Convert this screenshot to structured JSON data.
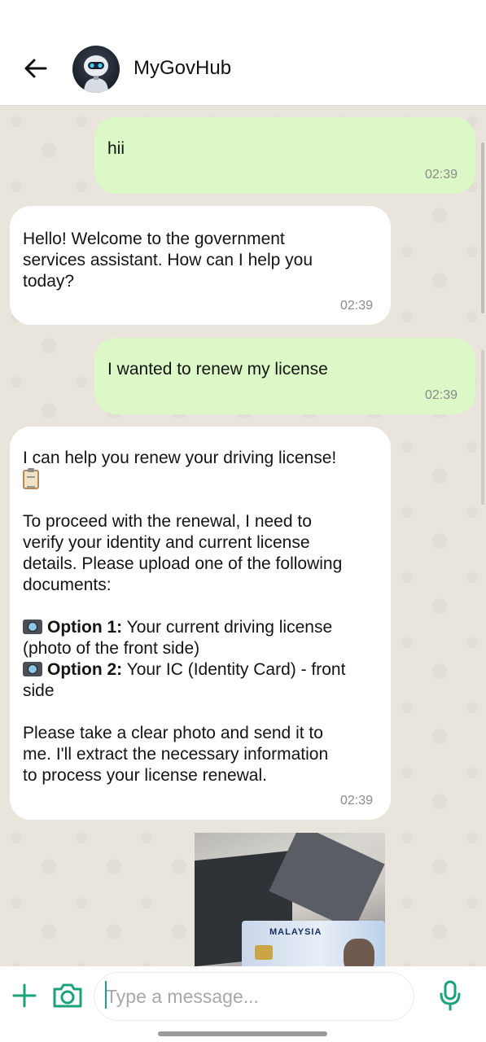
{
  "header": {
    "contact_name": "MyGovHub"
  },
  "messages": [
    {
      "direction": "outgoing",
      "lines": [
        "hii"
      ],
      "time": "02:39"
    },
    {
      "direction": "incoming",
      "lines": [
        "Hello! Welcome to the government",
        "services assistant. How can I help you",
        "today?"
      ],
      "time": "02:39"
    },
    {
      "direction": "outgoing",
      "lines": [
        "I wanted to renew my license"
      ],
      "time": "02:39"
    },
    {
      "direction": "incoming",
      "intro": "I can help you renew your driving license!",
      "para1": [
        "To proceed with the renewal, I need to",
        "verify your identity and current license",
        "details. Please upload one of the following",
        "documents:"
      ],
      "option1_label": "Option 1:",
      "option1_text": " Your current driving license",
      "option1_cont": "(photo of the front side)",
      "option2_label": "Option 2:",
      "option2_text": " Your IC (Identity Card) - front",
      "option2_cont": "side",
      "para2": [
        "Please take a clear photo and send it to",
        "me. I'll extract the necessary information",
        "to process your license renewal."
      ],
      "time": "02:39"
    }
  ],
  "photo_message": {
    "card_text": "MALAYSIA"
  },
  "composer": {
    "placeholder": "Type a message..."
  },
  "colors": {
    "outgoing_bubble": "#dcf8c6",
    "incoming_bubble": "#ffffff",
    "accent": "#1aa37a",
    "chat_background": "#e9e4dc"
  },
  "icons": [
    "back-arrow-icon",
    "plus-icon",
    "camera-icon",
    "microphone-icon"
  ]
}
